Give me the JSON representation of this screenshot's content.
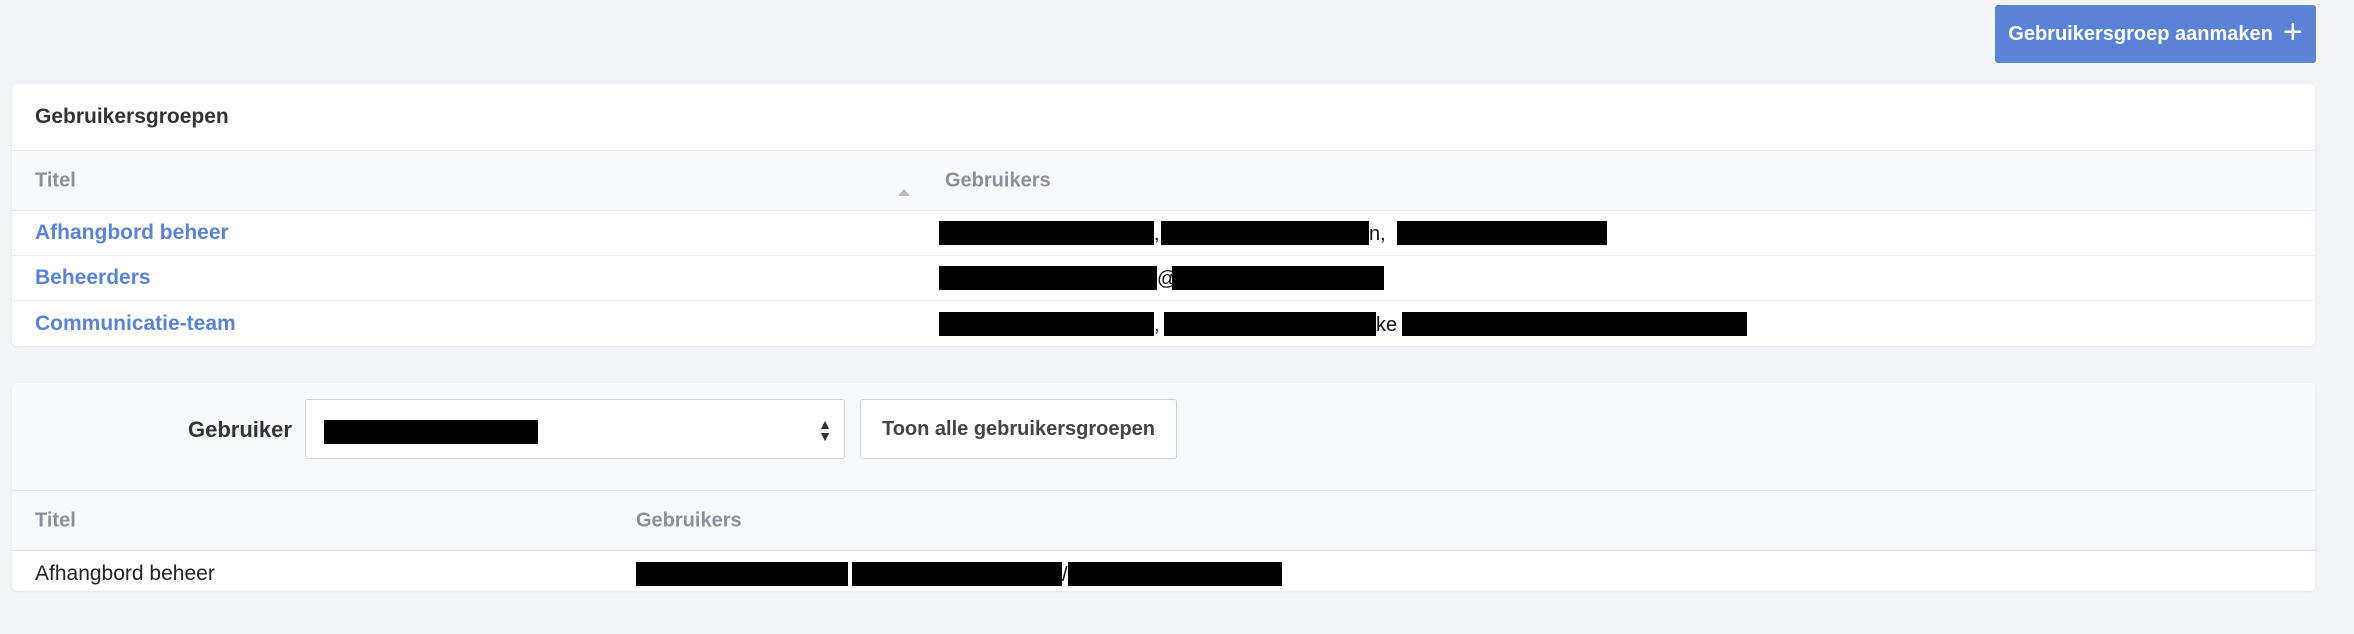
{
  "header": {
    "create_button_label": "Gebruikersgroep aanmaken",
    "create_button_icon": "plus-icon"
  },
  "groups_panel": {
    "title": "Gebruikersgroepen",
    "columns": {
      "title": "Titel",
      "users": "Gebruikers"
    },
    "rows": [
      {
        "title": "Afhangbord beheer",
        "separators": [
          ",",
          "n,"
        ]
      },
      {
        "title": "Beheerders",
        "separators": [
          "@"
        ]
      },
      {
        "title": "Communicatie-team",
        "separators": [
          ",",
          "ke"
        ]
      }
    ]
  },
  "filter_panel": {
    "label": "Gebruiker",
    "show_all_label": "Toon alle gebruikersgroepen",
    "columns": {
      "title": "Titel",
      "users": "Gebruikers"
    },
    "rows": [
      {
        "title": "Afhangbord beheer",
        "separators": [
          "/"
        ]
      }
    ]
  },
  "colors": {
    "accent": "#5a83d6",
    "background": "#f3f4f8",
    "redaction": "#000000"
  }
}
